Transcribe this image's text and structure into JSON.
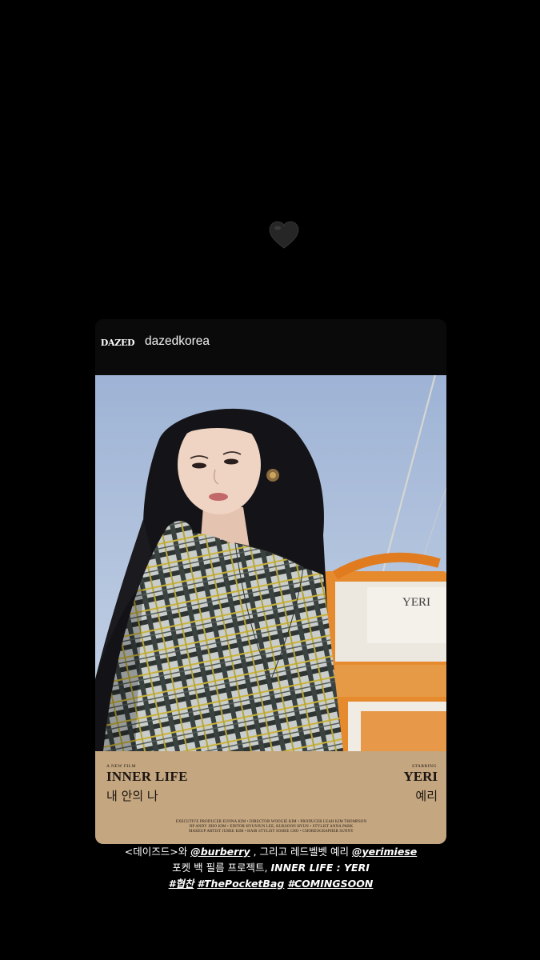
{
  "story": {
    "sticker_icon": "black-heart-icon",
    "post": {
      "avatar_text": "DAZED",
      "username": "dazedkorea",
      "poster": {
        "tagline": "A NEW FILM",
        "title": "INNER LIFE",
        "title_kr": "내 안의 나",
        "starring_label": "STARRING",
        "star": "YERI",
        "star_kr": "예리",
        "credits": [
          "EXECUTIVE PRODUCER EUNNA KIM • DIRECTOR WOOGIE KIM • PRODUCER LEAH KIM THOMPSON",
          "DP ANDY JIHO KIM • EDITOR HYUNJUN LEE, KUKSOON HYUN • STYLIST ANNA PARK",
          "MAKEUP ARTIST JUHEE KIM • HAIR STYLIST SOHEE CHO • CHOREOGRAPHER SUNNY"
        ]
      },
      "photo_bag_text": "YERI"
    },
    "caption": {
      "line1": {
        "part1": "<데이즈드>와 ",
        "mention1": "@burberry",
        "part2": " , 그리고 레드벨벳 예리 ",
        "mention2": "@yerimiese"
      },
      "line2": {
        "part1": "포켓 백 필름 프로젝트, ",
        "bold": "INNER LIFE : YERI"
      },
      "line3": {
        "tag1": "#협찬",
        "tag2": "#ThePocketBag",
        "tag3": "#COMINGSOON"
      }
    }
  },
  "colors": {
    "background": "#000000",
    "poster_band": "#c4a680",
    "bag_orange": "#e68a2e",
    "sky": "#b6c6df"
  }
}
